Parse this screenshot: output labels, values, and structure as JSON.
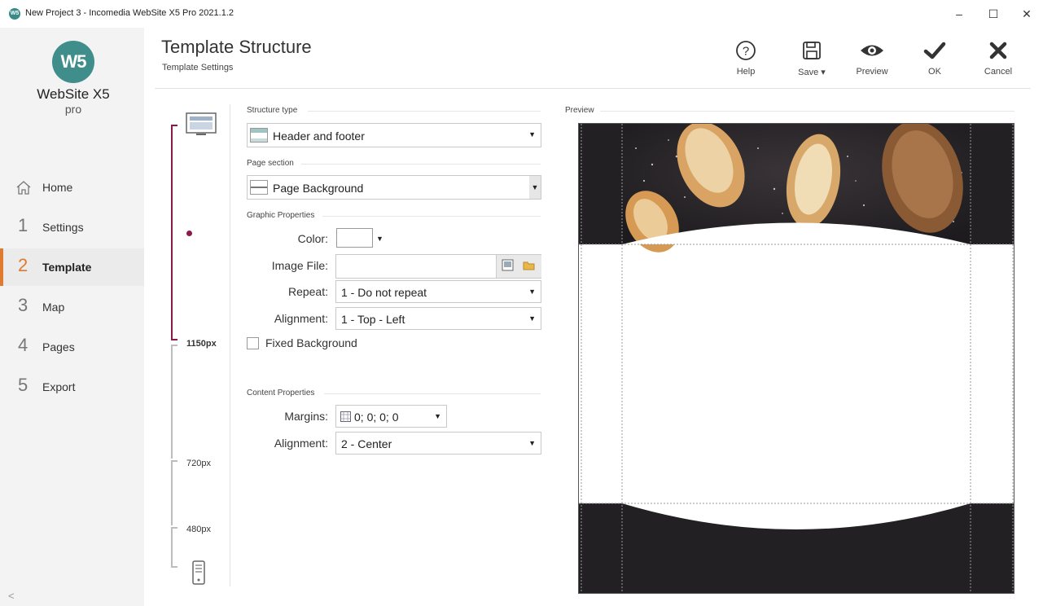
{
  "window": {
    "title": "New Project 3 - Incomedia WebSite X5 Pro 2021.1.2",
    "app_icon": "W5",
    "minimize": "–",
    "maximize": "☐",
    "close": "✕"
  },
  "sidebar": {
    "logo_mark": "W5",
    "logo_name": "WebSite X5",
    "logo_edition": "pro",
    "items": [
      {
        "num": "",
        "label": "Home",
        "icon": "home-icon"
      },
      {
        "num": "1",
        "label": "Settings"
      },
      {
        "num": "2",
        "label": "Template",
        "active": true
      },
      {
        "num": "3",
        "label": "Map"
      },
      {
        "num": "4",
        "label": "Pages"
      },
      {
        "num": "5",
        "label": "Export"
      }
    ],
    "collapse_glyph": "<",
    "accent": "#e07a2e"
  },
  "header": {
    "title": "Template Structure",
    "subtitle": "Template Settings"
  },
  "toolbar": {
    "help": "Help",
    "save": "Save ▾",
    "preview": "Preview",
    "ok": "OK",
    "cancel": "Cancel"
  },
  "breakpoints": {
    "labels": [
      "1150px",
      "720px",
      "480px"
    ],
    "active_color": "#8b1a4a"
  },
  "form": {
    "structure_type_label": "Structure type",
    "structure_type_value": "Header and footer",
    "page_section_label": "Page section",
    "page_section_value": "Page Background",
    "graphic_label": "Graphic Properties",
    "color_label": "Color:",
    "color_value": "#ffffff",
    "image_label": "Image File:",
    "image_value": "",
    "repeat_label": "Repeat:",
    "repeat_value": "1 - Do not repeat",
    "alignment_label": "Alignment:",
    "alignment_value": "1 - Top - Left",
    "fixed_bg_label": "Fixed Background",
    "fixed_bg_checked": false,
    "content_label": "Content Properties",
    "margins_label": "Margins:",
    "margins_value": "0; 0; 0; 0",
    "content_alignment_label": "Alignment:",
    "content_alignment_value": "2 - Center"
  },
  "preview": {
    "label": "Preview"
  }
}
